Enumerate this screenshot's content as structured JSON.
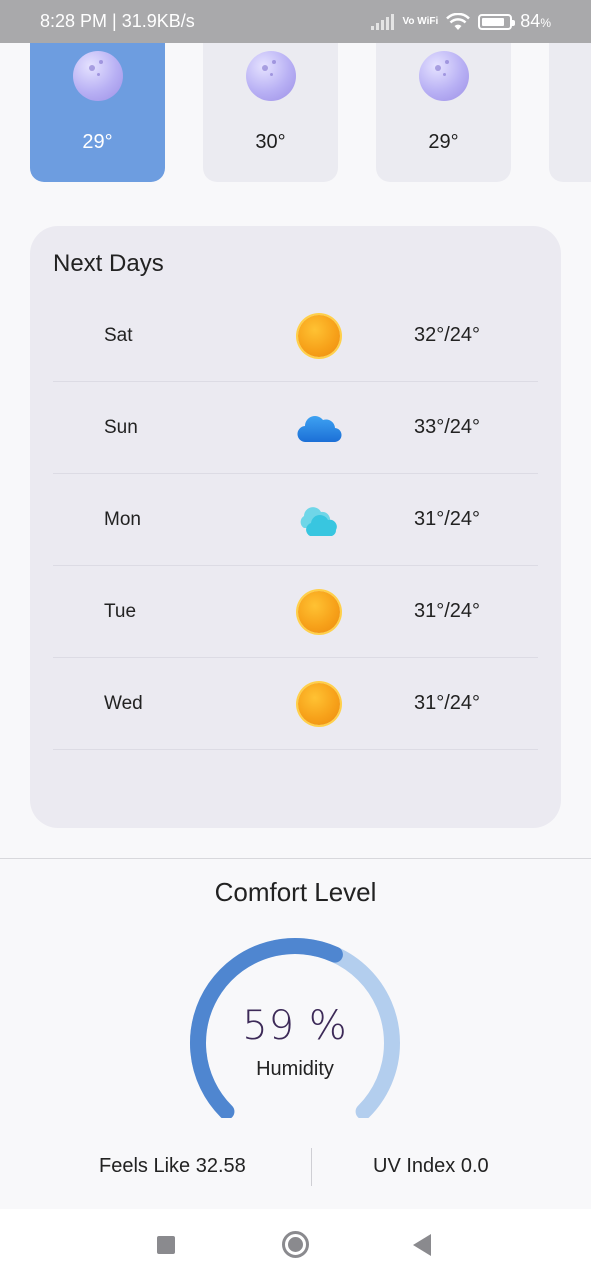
{
  "status_bar": {
    "time_speed": "8:28 PM | 31.9KB/s",
    "network_label": "Vo WiFi",
    "battery": "84",
    "battery_unit": "%",
    "battery_level": 0.84
  },
  "hourly": [
    {
      "icon": "moon-icon",
      "temp": "29°",
      "active": true
    },
    {
      "icon": "moon-icon",
      "temp": "30°",
      "active": false
    },
    {
      "icon": "moon-icon",
      "temp": "29°",
      "active": false
    }
  ],
  "next_days": {
    "title": "Next Days",
    "days": [
      {
        "day": "Sat",
        "icon": "sun-icon",
        "temp": "32°/24°"
      },
      {
        "day": "Sun",
        "icon": "cloud-icon",
        "temp": "33°/24°"
      },
      {
        "day": "Mon",
        "icon": "partly-cloudy-icon",
        "temp": "31°/24°"
      },
      {
        "day": "Tue",
        "icon": "sun-icon",
        "temp": "31°/24°"
      },
      {
        "day": "Wed",
        "icon": "sun-icon",
        "temp": "31°/24°"
      }
    ]
  },
  "comfort": {
    "title": "Comfort Level",
    "humidity_value": "59 %",
    "humidity_label": "Humidity",
    "humidity_fraction": 0.59,
    "feels_like": "Feels Like 32.58",
    "uv_index": "UV Index 0.0"
  },
  "colors": {
    "accent": "#6d9de0",
    "gauge_fill": "#4f86d0",
    "gauge_track": "#b3ceee",
    "card_bg": "#ebeaf1"
  }
}
